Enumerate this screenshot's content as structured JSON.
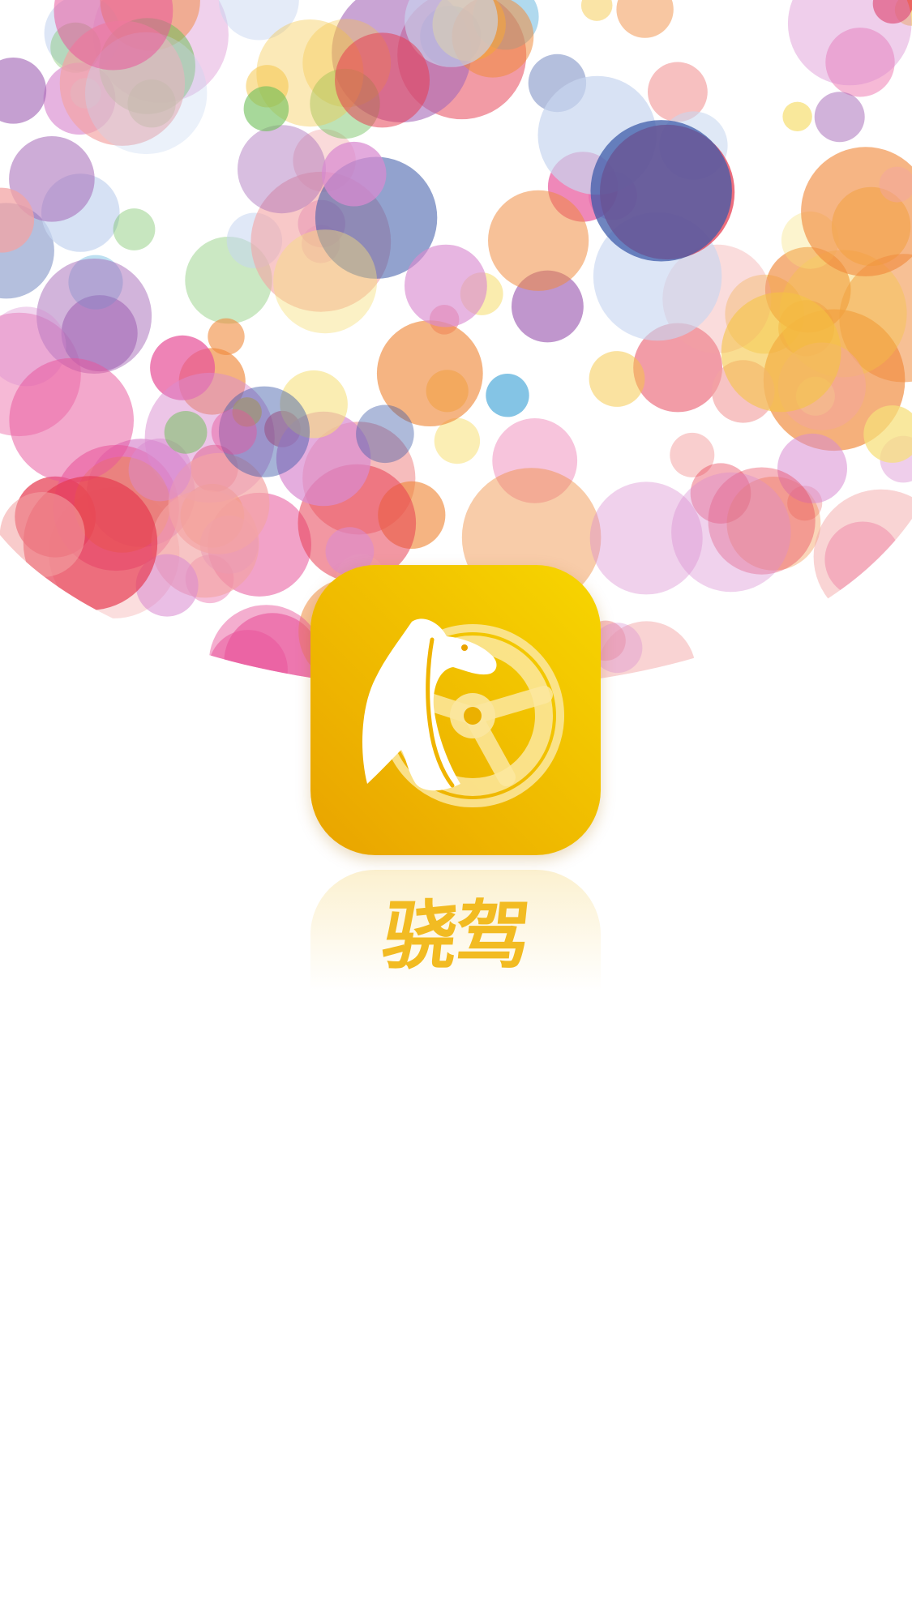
{
  "splash": {
    "app_name": "骁驾",
    "icon": "horse-head-steering-wheel-icon",
    "banner": "colorful-bubbles-background"
  },
  "colors": {
    "icon_gradient_top": "#f7d600",
    "icon_gradient_bottom": "#e9a300",
    "brand_text": "#f2bb22",
    "background": "#ffffff"
  }
}
